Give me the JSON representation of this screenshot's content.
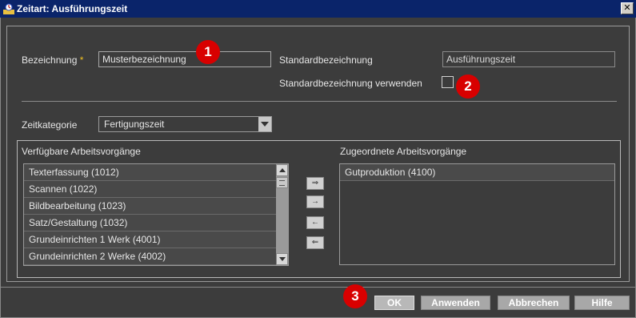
{
  "window": {
    "title": "Zeitart: Ausführungszeit",
    "close_glyph": "✕"
  },
  "form": {
    "bezeichnung_label": "Bezeichnung",
    "required_marker": "*",
    "bezeichnung_value": "Musterbezeichnung",
    "standard_label": "Standardbezeichnung",
    "standard_value": "Ausführungszeit",
    "use_standard_label": "Standardbezeichnung verwenden",
    "use_standard_checked": false,
    "zeitkategorie_label": "Zeitkategorie",
    "zeitkategorie_value": "Fertigungszeit"
  },
  "available": {
    "title": "Verfügbare Arbeitsvorgänge",
    "items": [
      "Texterfassung (1012)",
      "Scannen (1022)",
      "Bildbearbeitung (1023)",
      "Satz/Gestaltung (1032)",
      "Grundeinrichten 1 Werk (4001)",
      "Grundeinrichten 2 Werke (4002)"
    ]
  },
  "assigned": {
    "title": "Zugeordnete Arbeitsvorgänge",
    "items": [
      "Gutproduktion (4100)"
    ]
  },
  "transfer": {
    "add_all": "⇒",
    "add": "→",
    "remove": "←",
    "remove_all": "⇐"
  },
  "buttons": {
    "ok": "OK",
    "apply": "Anwenden",
    "cancel": "Abbrechen",
    "help": "Hilfe"
  },
  "badges": [
    "1",
    "2",
    "3"
  ],
  "colors": {
    "titlebar": "#0a246a",
    "background": "#3c3c3c",
    "badge": "#d80000"
  }
}
